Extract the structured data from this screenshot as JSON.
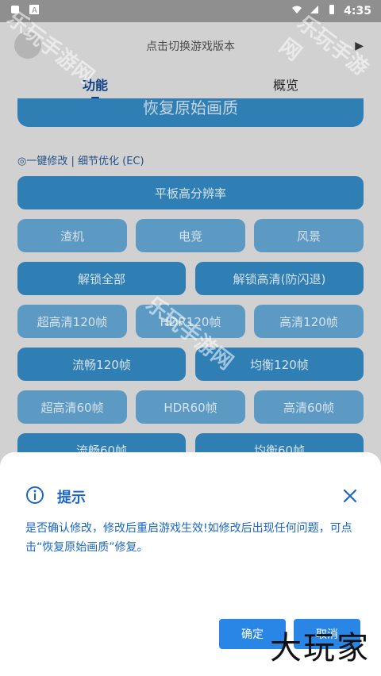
{
  "status_bar": {
    "time": "4:35"
  },
  "header": {
    "version_hint": "点击切换游戏版本"
  },
  "tabs": [
    {
      "label": "功能"
    },
    {
      "label": "概览"
    }
  ],
  "restore_button": "恢复原始画质",
  "section_label": "◎一键修改 | 细节优化 (EC)",
  "buttons": {
    "tablet_hd": "平板高分辨率",
    "potato": "渣机",
    "esports": "电竞",
    "scenery": "风景",
    "unlock_all": "解锁全部",
    "unlock_hd": "解锁高清(防闪退)",
    "ultra_hd_120": "超高清120帧",
    "hdr_120": "HDR120帧",
    "hd_120": "高清120帧",
    "smooth_120": "流畅120帧",
    "balanced_120": "均衡120帧",
    "ultra_hd_60": "超高清60帧",
    "hdr_60": "HDR60帧",
    "hd_60": "高清60帧",
    "smooth_60": "流畅60帧",
    "balanced_60": "均衡60帧"
  },
  "dialog": {
    "title": "提示",
    "message": "是否确认修改，修改后重启游戏生效!如修改后出现任何问题，可点击“恢复原始画质”修复。",
    "confirm_label": "确定",
    "cancel_label": "取消"
  },
  "watermarks": {
    "site": "乐玩手游网",
    "brand": "大玩家"
  },
  "colors": {
    "accent": "#2a86e6",
    "button_on": "#2f7fb5",
    "button_off": "#5c9ac4",
    "dialog_text": "#1a66c8"
  }
}
